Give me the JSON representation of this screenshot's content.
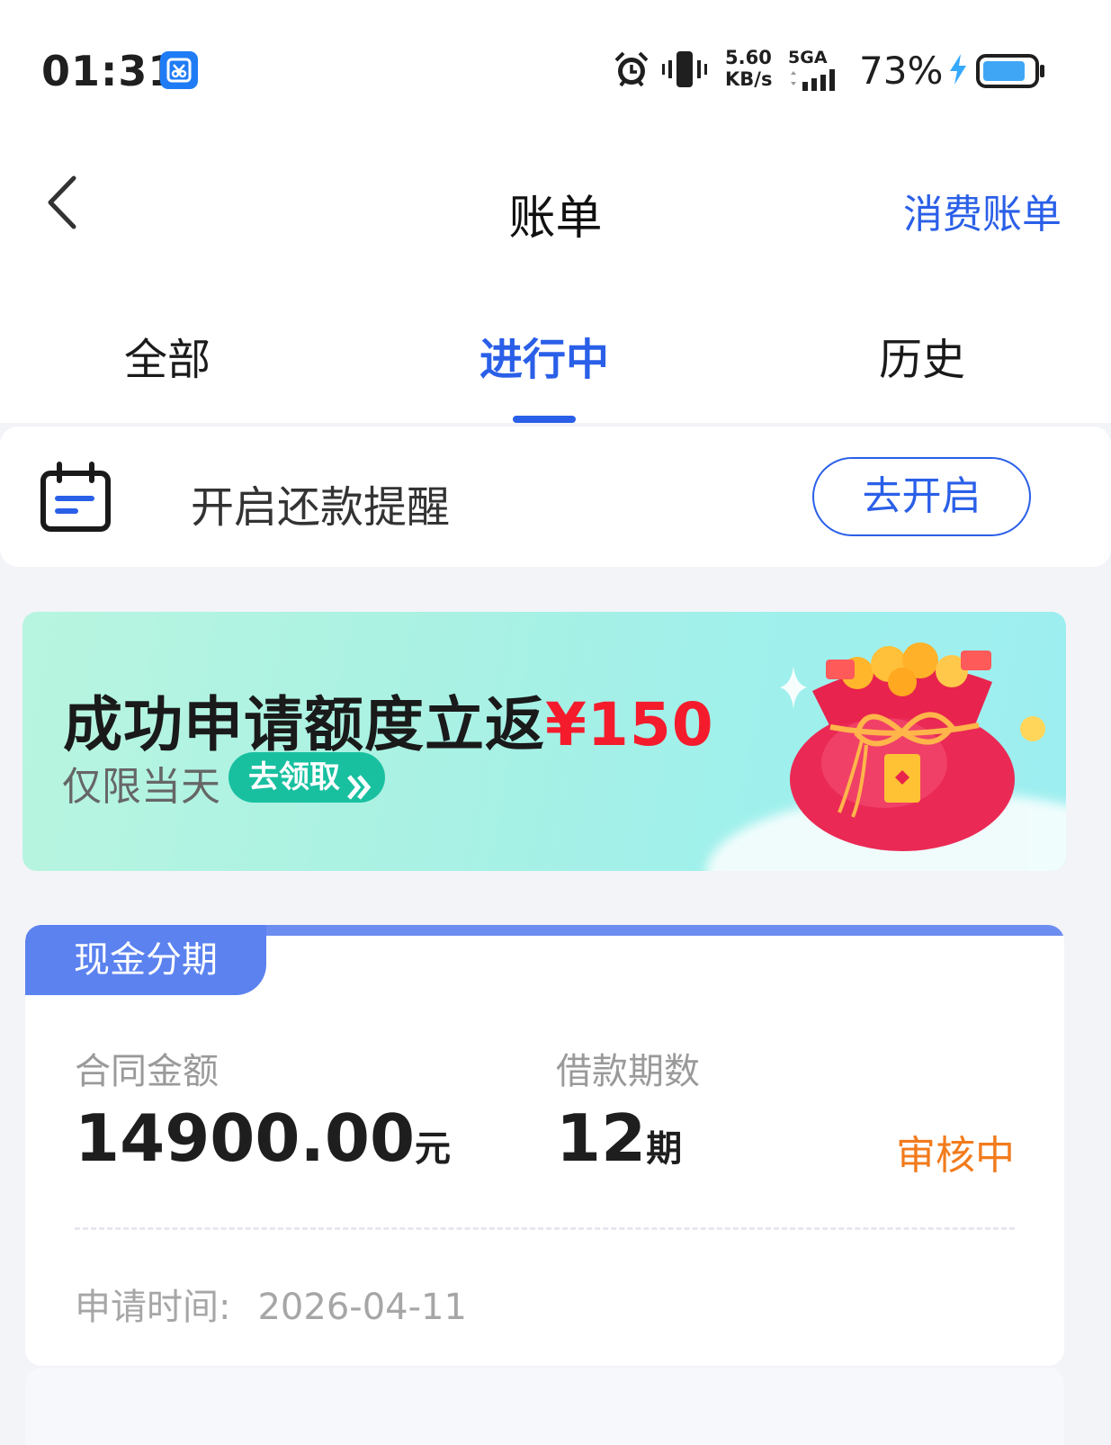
{
  "status_bar": {
    "time": "01:31",
    "app_icon": "scissors-app-icon",
    "speed_value": "5.60",
    "speed_unit": "KB/s",
    "network": "5GA",
    "battery_percent": "73%",
    "icons": [
      "alarm-icon",
      "vibrate-icon",
      "signal-icon",
      "charging-icon",
      "battery-icon"
    ]
  },
  "header": {
    "title": "账单",
    "right_link": "消费账单"
  },
  "tabs": [
    {
      "label": "全部",
      "active": false
    },
    {
      "label": "进行中",
      "active": true
    },
    {
      "label": "历史",
      "active": false
    }
  ],
  "reminder": {
    "text": "开启还款提醒",
    "button": "去开启"
  },
  "banner": {
    "headline": "成功申请额度立返",
    "amount": "¥150",
    "sub": "仅限当天",
    "cta": "去领取"
  },
  "loan_card": {
    "tag": "现金分期",
    "amount_label": "合同金额",
    "amount_value": "14900.00",
    "amount_unit": "元",
    "periods_label": "借款期数",
    "periods_value": "12",
    "periods_unit": "期",
    "status": "审核中",
    "apply_time_label": "申请时间:",
    "apply_time_value": "2026-04-11"
  },
  "colors": {
    "accent": "#2a5fe8",
    "status_orange": "#f27b1c",
    "promo_red": "#f41c2c",
    "tag_blue": "#5b82ef",
    "pill_green": "#18c0a0"
  }
}
